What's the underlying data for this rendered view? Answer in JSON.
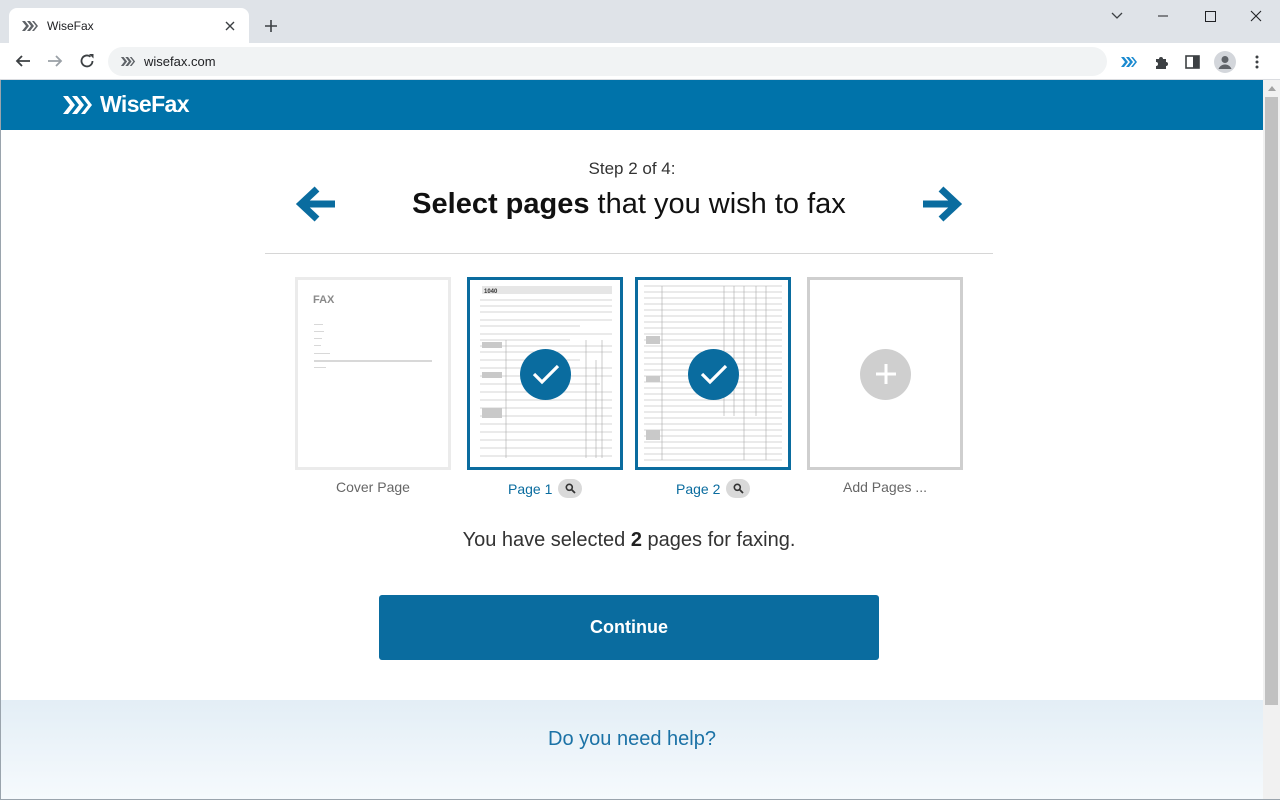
{
  "browser": {
    "tab_title": "WiseFax",
    "url": "wisefax.com",
    "icons": [
      "wisefax-favicon-icon",
      "close-icon",
      "plus-icon",
      "back-icon",
      "forward-icon",
      "reload-icon",
      "wisefax-extension-icon",
      "extensions-puzzle-icon",
      "sidepanel-icon",
      "profile-icon",
      "kebab-menu-icon",
      "minimize-icon",
      "maximize-icon",
      "window-close-icon",
      "tabs-chevron-icon"
    ]
  },
  "header": {
    "logo_text": "WiseFax",
    "brand_color": "#0073aa"
  },
  "step": {
    "label": "Step 2 of 4:",
    "headline_bold": "Select pages",
    "headline_rest": " that you wish to fax"
  },
  "pages": [
    {
      "label": "Cover Page",
      "selected": false,
      "kind": "cover",
      "cover_heading": "FAX"
    },
    {
      "label": "Page 1",
      "selected": true,
      "kind": "form"
    },
    {
      "label": "Page 2",
      "selected": true,
      "kind": "form"
    },
    {
      "label": "Add Pages ...",
      "selected": false,
      "kind": "add"
    }
  ],
  "summary": {
    "prefix": "You have selected ",
    "count": "2",
    "suffix": " pages for faxing."
  },
  "continue_label": "Continue",
  "help_text": "Do you need help?",
  "accent_color": "#0a6c9f"
}
